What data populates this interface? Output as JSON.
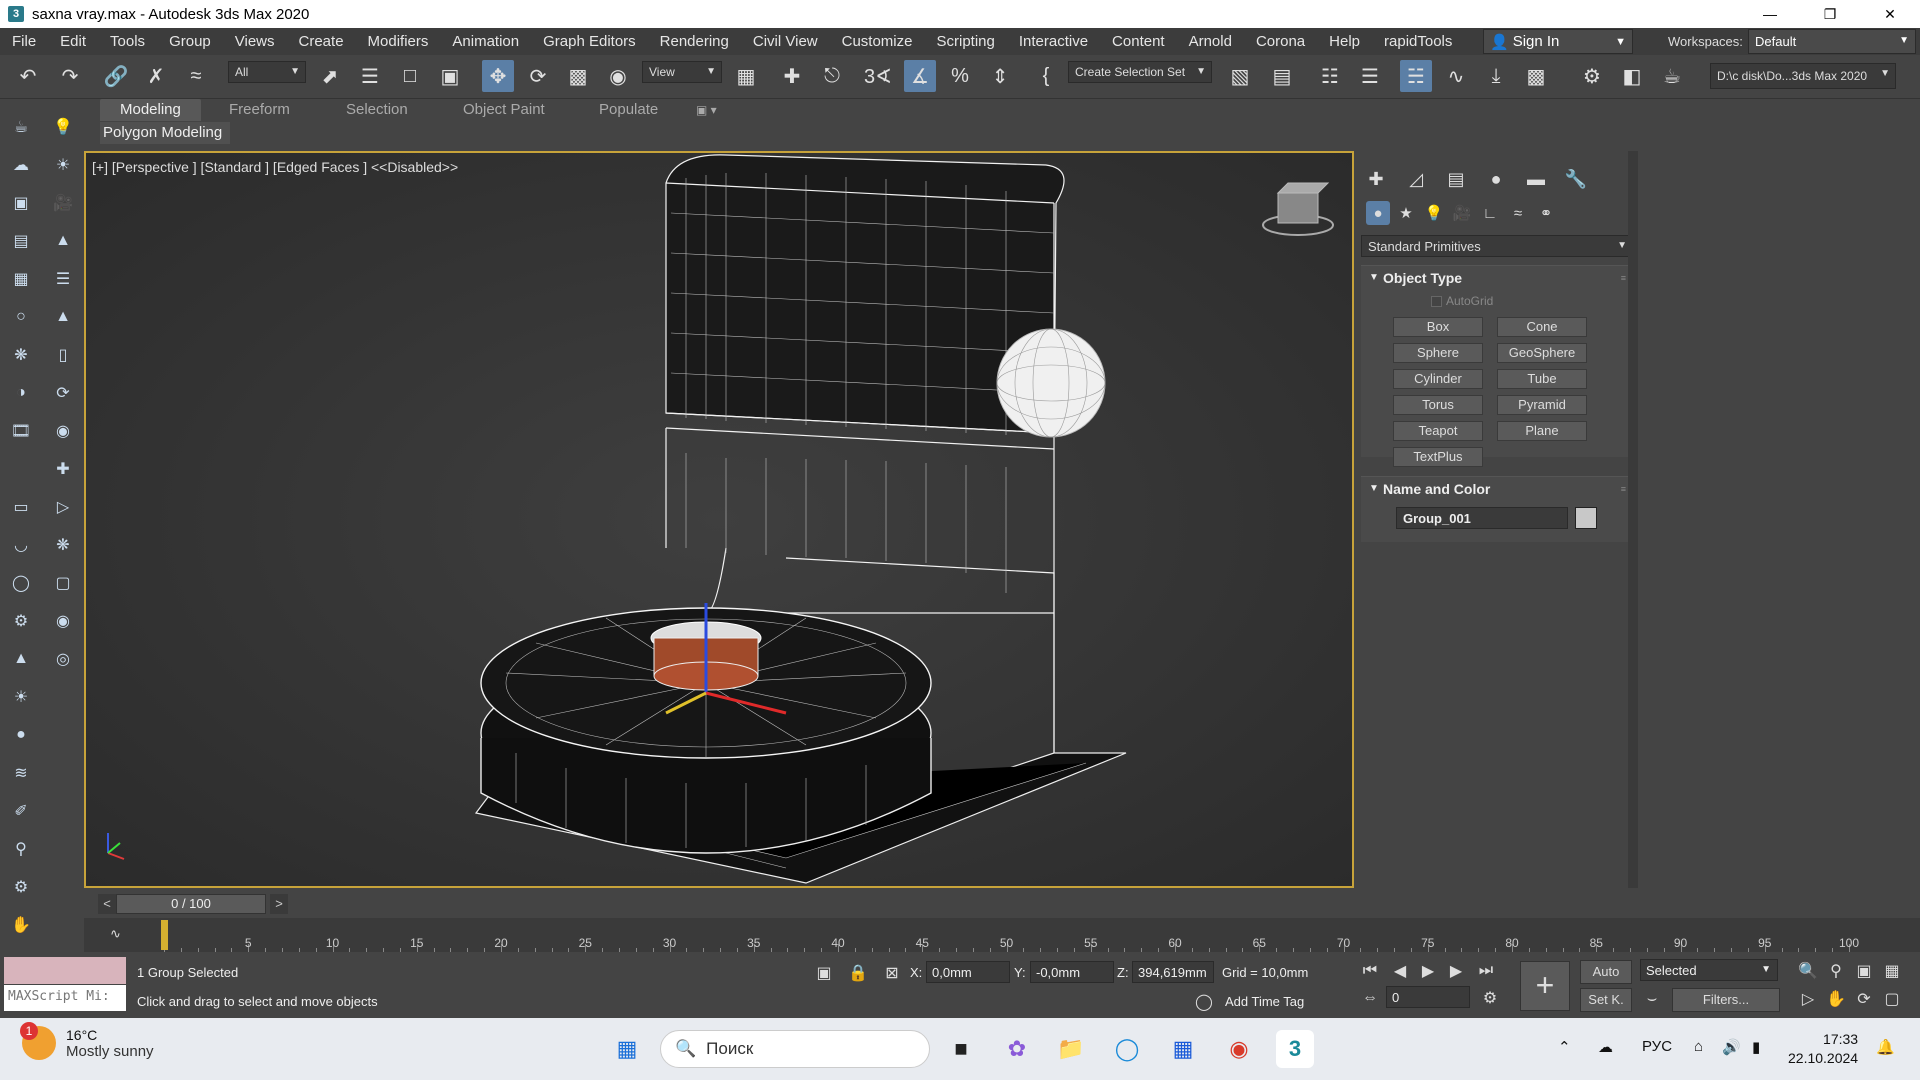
{
  "window": {
    "title": "saxna vray.max - Autodesk 3ds Max 2020",
    "app_icon": "3"
  },
  "menu": [
    "File",
    "Edit",
    "Tools",
    "Group",
    "Views",
    "Create",
    "Modifiers",
    "Animation",
    "Graph Editors",
    "Rendering",
    "Civil View",
    "Customize",
    "Scripting",
    "Interactive",
    "Content",
    "Arnold",
    "Corona",
    "Help",
    "rapidTools"
  ],
  "signin": {
    "label": "Sign In"
  },
  "workspace": {
    "label": "Workspaces:",
    "value": "Default"
  },
  "toolbar": {
    "filter": "All",
    "refcoord": "View",
    "selection_set": "Create Selection Set",
    "project_path": "D:\\c disk\\Do...3ds Max 2020"
  },
  "ribbon": {
    "tabs": [
      "Modeling",
      "Freeform",
      "Selection",
      "Object Paint",
      "Populate"
    ],
    "active": "Modeling",
    "panel": "Polygon Modeling"
  },
  "viewport": {
    "label": "[+] [Perspective ] [Standard ] [Edged Faces ]  <<Disabled>>"
  },
  "command_panel": {
    "category": "Standard Primitives",
    "object_type": {
      "title": "Object Type",
      "autogrid": "AutoGrid",
      "buttons": [
        "Box",
        "Cone",
        "Sphere",
        "GeoSphere",
        "Cylinder",
        "Tube",
        "Torus",
        "Pyramid",
        "Teapot",
        "Plane",
        "TextPlus"
      ]
    },
    "name_color": {
      "title": "Name and Color",
      "name": "Group_001",
      "color": "#c8c8c8"
    }
  },
  "timeline": {
    "frame": "0 / 100",
    "ticks": [
      "5",
      "10",
      "15",
      "20",
      "25",
      "30",
      "35",
      "40",
      "45",
      "50",
      "55",
      "60",
      "65",
      "70",
      "75",
      "80",
      "85",
      "90",
      "95",
      "100"
    ]
  },
  "status": {
    "maxscript": "MAXScript Mi:",
    "selection": "1 Group Selected",
    "prompt": "Click and drag to select and move objects",
    "x_label": "X:",
    "x": "0,0mm",
    "y_label": "Y:",
    "y": "-0,0mm",
    "z_label": "Z:",
    "z": "394,619mm",
    "grid": "Grid = 10,0mm",
    "add_time_tag": "Add Time Tag",
    "auto": "Auto",
    "set_key": "Set K.",
    "key_filter": "Selected",
    "filters": "Filters...",
    "current_frame": "0"
  },
  "taskbar": {
    "weather_temp": "16°C",
    "weather_desc": "Mostly sunny",
    "weather_badge": "1",
    "search": "Поиск",
    "lang": "РУС",
    "time": "17:33",
    "date": "22.10.2024"
  }
}
